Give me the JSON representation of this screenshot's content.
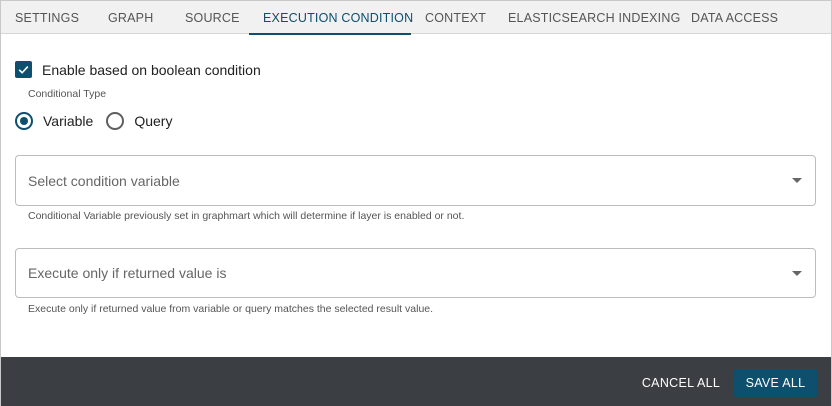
{
  "tabs": [
    {
      "label": "SETTINGS"
    },
    {
      "label": "GRAPH"
    },
    {
      "label": "SOURCE"
    },
    {
      "label": "EXECUTION CONDITION",
      "active": true
    },
    {
      "label": "CONTEXT"
    },
    {
      "label": "ELASTICSEARCH INDEXING"
    },
    {
      "label": "DATA ACCESS"
    }
  ],
  "enable_checkbox": {
    "label": "Enable based on boolean condition",
    "checked": true
  },
  "conditional_type": {
    "label": "Conditional Type",
    "options": [
      {
        "label": "Variable",
        "selected": true
      },
      {
        "label": "Query",
        "selected": false
      }
    ]
  },
  "condition_variable": {
    "placeholder": "Select condition variable",
    "hint": "Conditional Variable previously set in graphmart which will determine if layer is enabled or not."
  },
  "returned_value": {
    "placeholder": "Execute only if returned value is",
    "hint": "Execute only if returned value from variable or query matches the selected result value."
  },
  "footer": {
    "cancel_label": "CANCEL ALL",
    "save_label": "SAVE ALL"
  },
  "colors": {
    "accent": "#0d4f6c",
    "footer_bg": "#3b3e42",
    "tabbar_bg": "#f1f1f1"
  }
}
